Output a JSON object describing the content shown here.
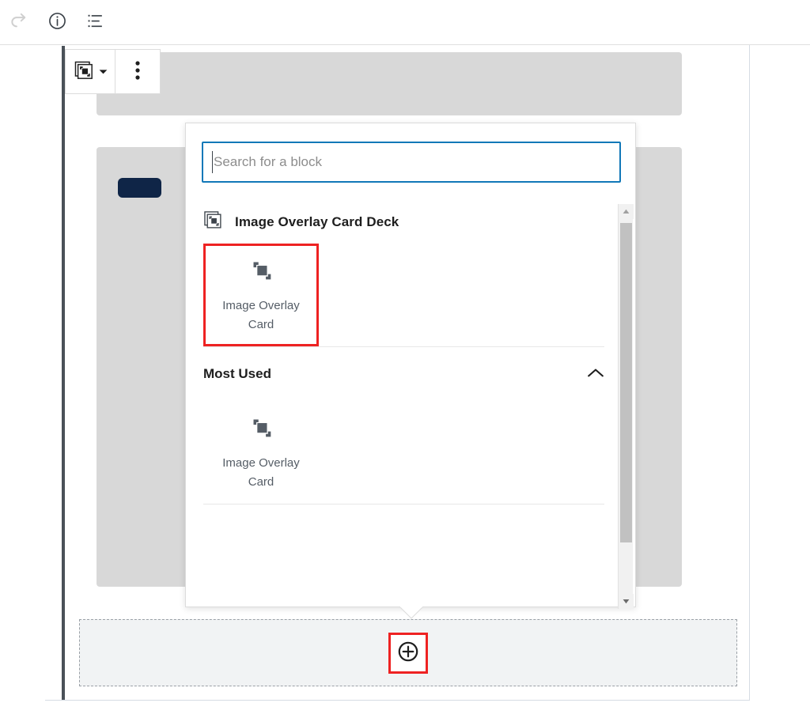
{
  "top_toolbar": {
    "buttons": [
      {
        "name": "redo-icon",
        "label": "Redo",
        "state": "disabled"
      },
      {
        "name": "info-icon",
        "label": "Details",
        "state": "enabled"
      },
      {
        "name": "list-view-icon",
        "label": "List View",
        "state": "enabled"
      }
    ]
  },
  "block_toolbar": {
    "block_type_label": "Image Overlay Card Deck",
    "block_type_icon": "image-overlay-card-deck-icon",
    "dropdown_icon": "chevron-down-icon",
    "more_options_label": "Options",
    "more_options_icon": "more-vertical-icon"
  },
  "canvas": {
    "appender_label": "Add block",
    "add_block_icon": "plus-circle-icon",
    "highlight_color": "#ee2222",
    "navy_pill_color": "#0f2547",
    "placeholder_color": "#d8d8d8"
  },
  "inserter": {
    "search": {
      "placeholder": "Search for a block",
      "value": "",
      "focus_color": "#1178b8"
    },
    "category": {
      "title": "Image Overlay Card Deck",
      "icon": "image-overlay-card-deck-icon",
      "blocks": [
        {
          "label": "Image Overlay Card",
          "icon": "image-overlay-card-icon",
          "highlighted": true
        }
      ]
    },
    "panel": {
      "title": "Most Used",
      "toggle_icon": "chevron-up-icon",
      "expanded": true,
      "blocks": [
        {
          "label": "Image Overlay Card",
          "icon": "image-overlay-card-icon",
          "highlighted": false
        }
      ]
    },
    "scrollbar": {
      "up_icon": "scroll-up-arrow-icon",
      "down_icon": "scroll-down-arrow-icon",
      "thumb_name": "scrollbar-thumb"
    }
  }
}
